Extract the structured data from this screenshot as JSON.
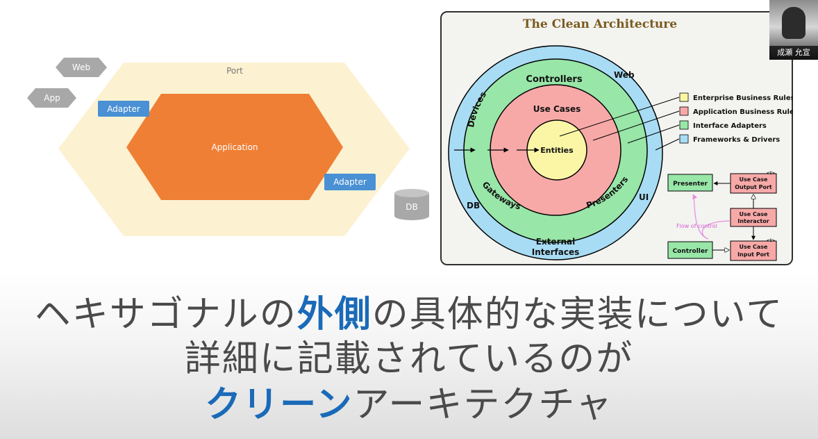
{
  "hexagonal": {
    "web_label": "Web",
    "app_label": "App",
    "port_label": "Port",
    "adapter_top_label": "Adapter",
    "application_label": "Application",
    "adapter_bottom_label": "Adapter",
    "db_label": "DB"
  },
  "clean": {
    "title": "The Clean Architecture",
    "rings": {
      "devices": "Devices",
      "web": "Web",
      "controllers": "Controllers",
      "use_cases": "Use Cases",
      "entities": "Entities",
      "gateways": "Gateways",
      "presenters": "Presenters",
      "db": "DB",
      "ui": "UI",
      "external_line1": "External",
      "external_line2": "Interfaces"
    },
    "legend": [
      {
        "label": "Enterprise Business Rules",
        "color": "#fbf6a6"
      },
      {
        "label": "Application Business Rules",
        "color": "#f7a9a8"
      },
      {
        "label": "Interface Adapters",
        "color": "#98e6a8"
      },
      {
        "label": "Frameworks & Drivers",
        "color": "#a8dcf4"
      }
    ],
    "flow": {
      "presenter": "Presenter",
      "output_port_line1": "Use Case",
      "output_port_line2": "Output Port",
      "interactor_line1": "Use Case",
      "interactor_line2": "Interactor",
      "controller": "Controller",
      "input_port_line1": "Use Case",
      "input_port_line2": "Input Port",
      "flow_of_control": "Flow of control",
      "interface_marker": "<I>"
    }
  },
  "caption": {
    "line1_a": "ヘキサゴナルの",
    "line1_highlight": "外側",
    "line1_b": "の具体的な実装について",
    "line2": "詳細に記載されているのが",
    "line3_highlight": "クリーン",
    "line3_b": "アーキテクチャ"
  },
  "webcam": {
    "name": "成瀬 允宣"
  },
  "colors": {
    "hex_outer": "#fcf2d2",
    "hex_inner": "#ef7f35",
    "adapter": "#4a90d4",
    "node_gray": "#a8a8a8",
    "caption_text": "#4a4a4a",
    "caption_highlight": "#1a6ab8"
  }
}
